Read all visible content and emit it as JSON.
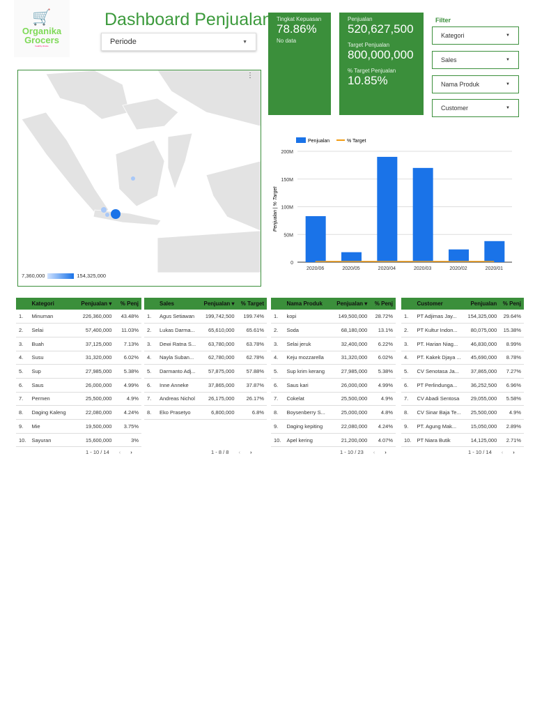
{
  "logo": {
    "line1": "Organika",
    "line2": "Grocers",
    "tagline": "healthy choice"
  },
  "header": {
    "title": "Dashboard Penjualan",
    "periode": "Periode"
  },
  "kpi1": {
    "label": "Tingkat Kepuasan",
    "value": "78.86%",
    "note": "No data"
  },
  "kpi2": {
    "label1": "Penjualan",
    "value1": "520,627,500",
    "label2": "Target Penjualan",
    "value2": "800,000,000",
    "label3": "% Target Penjualan",
    "value3": "10.85%"
  },
  "filter": {
    "title": "Filter",
    "items": [
      "Kategori",
      "Sales",
      "Nama Produk",
      "Customer"
    ]
  },
  "map": {
    "legend_min": "7,360,000",
    "legend_max": "154,325,000",
    "colors": {
      "low": "#cfe2ff",
      "high": "#1a73e8"
    }
  },
  "chart_data": {
    "type": "bar",
    "categories": [
      "2020/06",
      "2020/05",
      "2020/04",
      "2020/03",
      "2020/02",
      "2020/01"
    ],
    "series": [
      {
        "name": "Penjualan",
        "values": [
          83000000,
          18000000,
          190000000,
          170000000,
          23000000,
          38000000
        ],
        "color": "#1a73e8"
      },
      {
        "name": "% Target",
        "values": [
          0.08,
          0.02,
          0.19,
          0.17,
          0.02,
          0.04
        ],
        "color": "#f39c12"
      }
    ],
    "ylabel": "Penjualan | % Target",
    "ylim": [
      0,
      200000000
    ],
    "yticks": [
      "0",
      "50M",
      "100M",
      "150M",
      "200M"
    ],
    "legend": "top"
  },
  "tables": [
    {
      "headers": [
        "Kategori",
        "Penjualan ▾",
        "% Penj"
      ],
      "rows": [
        [
          "1.",
          "Minuman",
          "226,360,000",
          "43.48%"
        ],
        [
          "2.",
          "Selai",
          "57,400,000",
          "11.03%"
        ],
        [
          "3.",
          "Buah",
          "37,125,000",
          "7.13%"
        ],
        [
          "4.",
          "Susu",
          "31,320,000",
          "6.02%"
        ],
        [
          "5.",
          "Sup",
          "27,985,000",
          "5.38%"
        ],
        [
          "6.",
          "Saus",
          "26,000,000",
          "4.99%"
        ],
        [
          "7.",
          "Permen",
          "25,500,000",
          "4.9%"
        ],
        [
          "8.",
          "Daging Kaleng",
          "22,080,000",
          "4.24%"
        ],
        [
          "9.",
          "Mie",
          "19,500,000",
          "3.75%"
        ],
        [
          "10.",
          "Sayuran",
          "15,600,000",
          "3%"
        ]
      ],
      "pager": "1 - 10 / 14"
    },
    {
      "headers": [
        "Sales",
        "Penjualan ▾",
        "% Target"
      ],
      "rows": [
        [
          "1.",
          "Agus Setiawan",
          "199,742,500",
          "199.74%"
        ],
        [
          "2.",
          "Lukas Darma...",
          "65,610,000",
          "65.61%"
        ],
        [
          "3.",
          "Dewi Ratna S...",
          "63,780,000",
          "63.78%"
        ],
        [
          "4.",
          "Nayla Suban...",
          "62,780,000",
          "62.78%"
        ],
        [
          "5.",
          "Darmanto Adj...",
          "57,875,000",
          "57.88%"
        ],
        [
          "6.",
          "Inne Anneke",
          "37,865,000",
          "37.87%"
        ],
        [
          "7.",
          "Andreas Nichol",
          "26,175,000",
          "26.17%"
        ],
        [
          "8.",
          "Eko Prasetyo",
          "6,800,000",
          "6.8%"
        ]
      ],
      "pager": "1 - 8 / 8"
    },
    {
      "headers": [
        "Nama Produk",
        "Penjualan ▾",
        "% Penj"
      ],
      "rows": [
        [
          "1.",
          "kopi",
          "149,500,000",
          "28.72%"
        ],
        [
          "2.",
          "Soda",
          "68,180,000",
          "13.1%"
        ],
        [
          "3.",
          "Selai jeruk",
          "32,400,000",
          "6.22%"
        ],
        [
          "4.",
          "Keju mozzarella",
          "31,320,000",
          "6.02%"
        ],
        [
          "5.",
          "Sup krim kerang",
          "27,985,000",
          "5.38%"
        ],
        [
          "6.",
          "Saus kari",
          "26,000,000",
          "4.99%"
        ],
        [
          "7.",
          "Cokelat",
          "25,500,000",
          "4.9%"
        ],
        [
          "8.",
          "Boysenberry S...",
          "25,000,000",
          "4.8%"
        ],
        [
          "9.",
          "Daging kepiting",
          "22,080,000",
          "4.24%"
        ],
        [
          "10.",
          "Apel kering",
          "21,200,000",
          "4.07%"
        ]
      ],
      "pager": "1 - 10 / 23"
    },
    {
      "headers": [
        "Customer",
        "Penjualan",
        "% Penj"
      ],
      "rows": [
        [
          "1.",
          "PT Adjimas Jay...",
          "154,325,000",
          "29.64%"
        ],
        [
          "2.",
          "PT Kultur Indon...",
          "80,075,000",
          "15.38%"
        ],
        [
          "3.",
          "PT. Harian Niag...",
          "46,830,000",
          "8.99%"
        ],
        [
          "4.",
          "PT. Kakek Djaya ...",
          "45,690,000",
          "8.78%"
        ],
        [
          "5.",
          "CV Senotasa Ja...",
          "37,865,000",
          "7.27%"
        ],
        [
          "6.",
          "PT Perlindunga...",
          "36,252,500",
          "6.96%"
        ],
        [
          "7.",
          "CV Abadi Sentosa",
          "29,055,000",
          "5.58%"
        ],
        [
          "8.",
          "CV Sinar Baja Te...",
          "25,500,000",
          "4.9%"
        ],
        [
          "9.",
          "PT. Agung Mak...",
          "15,050,000",
          "2.89%"
        ],
        [
          "10.",
          "PT Niara Butik",
          "14,125,000",
          "2.71%"
        ]
      ],
      "pager": "1 - 10 / 14"
    }
  ]
}
